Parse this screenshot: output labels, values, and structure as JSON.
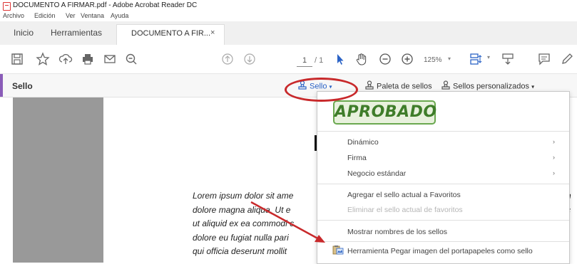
{
  "window": {
    "title": "DOCUMENTO A FIRMAR.pdf - Adobe Acrobat Reader DC"
  },
  "menu": [
    {
      "label": "Archivo"
    },
    {
      "label": "Edición"
    },
    {
      "label": "Ver"
    },
    {
      "label": "Ventana"
    },
    {
      "label": "Ayuda"
    }
  ],
  "tabs": {
    "home": "Inicio",
    "tools": "Herramientas",
    "document": "DOCUMENTO A FIR...",
    "close": "×"
  },
  "toolbar": {
    "page_current": "1",
    "page_total": "/ 1",
    "zoom": "125%",
    "icons": [
      "save-icon",
      "star-icon",
      "upload-icon",
      "print-icon",
      "mail-icon",
      "zoom-out-search-icon",
      "page-up-icon",
      "page-down-icon",
      "select-arrow-icon",
      "hand-icon",
      "zoom-out-icon",
      "zoom-in-icon",
      "fit-page-icon",
      "marquee-icon",
      "comment-icon",
      "pen-icon"
    ]
  },
  "stampbar": {
    "title": "Sello",
    "sello_button": "Sello",
    "palette_button": "Paleta de sellos",
    "custom_button": "Sellos personalizados",
    "accent_color": "#8a5cb8"
  },
  "dropdown": {
    "stamp_preview": "APROBADO",
    "items": [
      {
        "label": "Dinámico",
        "submenu": true
      },
      {
        "label": "Firma",
        "submenu": true
      },
      {
        "label": "Negocio estándar",
        "submenu": true
      },
      {
        "label": "Agregar el sello actual a Favoritos"
      },
      {
        "label": "Eliminar el sello actual de favoritos",
        "disabled": true
      },
      {
        "label": "Mostrar nombres de los sellos"
      },
      {
        "label": "Herramienta Pegar imagen del portapapeles como sello"
      }
    ],
    "submenu_arrow": "›"
  },
  "document": {
    "lines": [
      "Lorem ipsum dolor sit ame",
      "dolore magna aliqua. Ut e",
      "ut aliquid ex ea commodi c",
      "dolore eu fugiat nulla pari",
      "qui officia deserunt mollit"
    ],
    "right_fragments": [
      "n",
      "c",
      "l",
      "i"
    ]
  },
  "annotations": {
    "highlight_color": "#c8292b"
  }
}
